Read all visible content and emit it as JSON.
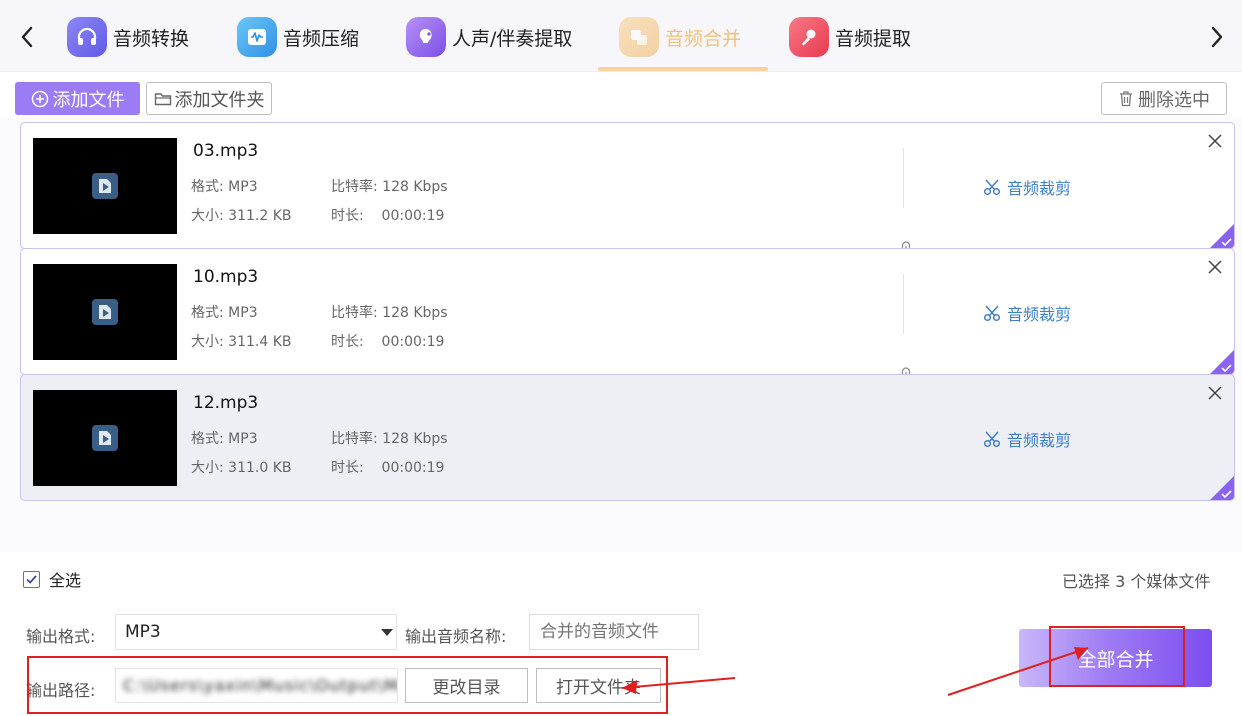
{
  "tabs": [
    {
      "label": "音频转换",
      "icon": "headphones-icon",
      "color": "#7b6cf2",
      "active": false
    },
    {
      "label": "音频压缩",
      "icon": "waveform-icon",
      "color": "#3aa6f0",
      "active": false
    },
    {
      "label": "人声/伴奏提取",
      "icon": "voice-icon",
      "color": "#9a62ee",
      "active": false
    },
    {
      "label": "音频合并",
      "icon": "merge-icon",
      "color": "#f5b04a",
      "active": true
    },
    {
      "label": "音频提取",
      "icon": "microphone-icon",
      "color": "#f05a6a",
      "active": false
    }
  ],
  "toolbar": {
    "add_file": "添加文件",
    "add_folder": "添加文件夹",
    "delete_selected": "删除选中"
  },
  "labels": {
    "format": "格式:",
    "bitrate": "比特率:",
    "size": "大小:",
    "duration": "时长:",
    "trim": "音频裁剪"
  },
  "files": [
    {
      "name": "03.mp3",
      "format": "MP3",
      "bitrate": "128 Kbps",
      "size": "311.2 KB",
      "duration": "00:00:19"
    },
    {
      "name": "10.mp3",
      "format": "MP3",
      "bitrate": "128 Kbps",
      "size": "311.4 KB",
      "duration": "00:00:19"
    },
    {
      "name": "12.mp3",
      "format": "MP3",
      "bitrate": "128 Kbps",
      "size": "311.0 KB",
      "duration": "00:00:19"
    }
  ],
  "footer": {
    "select_all": "全选",
    "selected_count": "已选择 3 个媒体文件"
  },
  "output": {
    "format_label": "输出格式:",
    "format_value": "MP3",
    "name_label": "输出音频名称:",
    "name_placeholder": "合并的音频文件",
    "path_label": "输出路径:",
    "path_value": "C:\\Users\\yaxin\\Music\\Output\\Merge",
    "change_dir": "更改目录",
    "open_folder": "打开文件夹",
    "merge_all": "全部合并"
  },
  "colors": {
    "accent": "#9b7cf4",
    "trim_link": "#3f7fc9",
    "annotation": "#e02020"
  }
}
